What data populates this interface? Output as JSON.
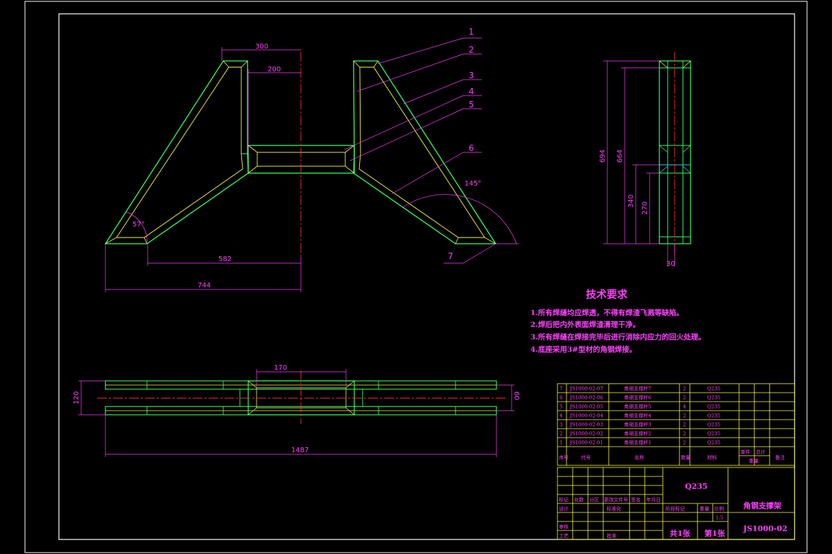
{
  "drawing": {
    "title_cn": "角钢支撑架",
    "drawing_no": "JS1000-02",
    "material": "Q235",
    "scale": "1:5",
    "sheets_total": "共1张",
    "sheet_no": "第1张"
  },
  "balloons": [
    "1",
    "2",
    "3",
    "4",
    "5",
    "6",
    "7"
  ],
  "dimensions": {
    "front": {
      "top_width": "300",
      "inner_width": "200",
      "lower_width": "582",
      "overall_half_width": "744",
      "left_angle": "57°",
      "right_angle": "145°"
    },
    "side": {
      "total_height": "694",
      "inner_height": "664",
      "mid_height": "340",
      "low_height": "270",
      "thickness": "30"
    },
    "bottom": {
      "center_width": "170",
      "overall_length": "1487",
      "overall_height": "120",
      "beam_height": "60"
    }
  },
  "technical_requirements": {
    "title": "技术要求",
    "lines": [
      "1.所有焊缝均应焊透，不得有焊渣飞溅等缺陷。",
      "2.焊后把内外表面焊渣清理干净。",
      "3.所有焊缝在焊接完毕后进行消除内应力的回火处理。",
      "4.底座采用3#型材的角钢焊接。"
    ]
  },
  "parts_list": {
    "rows": [
      {
        "no": "7",
        "code": "JS1000-02-07",
        "name": "角钢支撑杆7",
        "qty": "2",
        "material": "Q235"
      },
      {
        "no": "6",
        "code": "JS1000-02-06",
        "name": "角钢支撑杆6",
        "qty": "2",
        "material": "Q235"
      },
      {
        "no": "5",
        "code": "JS1000-02-05",
        "name": "角钢支撑杆5",
        "qty": "4",
        "material": "Q235"
      },
      {
        "no": "4",
        "code": "JS1000-02-04",
        "name": "角钢支撑杆4",
        "qty": "2",
        "material": "Q235"
      },
      {
        "no": "3",
        "code": "JS1000-02-03",
        "name": "角钢支撑杆3",
        "qty": "2",
        "material": "Q235"
      },
      {
        "no": "2",
        "code": "JS1000-02-02",
        "name": "角钢支撑杆2",
        "qty": "2",
        "material": "Q235"
      },
      {
        "no": "1",
        "code": "JS1000-02-01",
        "name": "角钢支撑杆1",
        "qty": "2",
        "material": "Q235"
      }
    ],
    "headers": {
      "no": "序号",
      "code": "代号",
      "name": "名称",
      "qty": "数量",
      "material": "材料",
      "unit_weight": "单件",
      "total_weight": "总计",
      "weight": "重量",
      "note": "备注"
    }
  },
  "title_block": {
    "row_labels": [
      "标记",
      "处数",
      "分区",
      "更改文件号",
      "签名",
      "年月日"
    ],
    "design": "设计",
    "standardize": "标准化",
    "review": "审核",
    "process": "工艺",
    "approve": "批准",
    "stage_mark": "阶段标记",
    "weight": "重量",
    "scale_label": "比例"
  }
}
